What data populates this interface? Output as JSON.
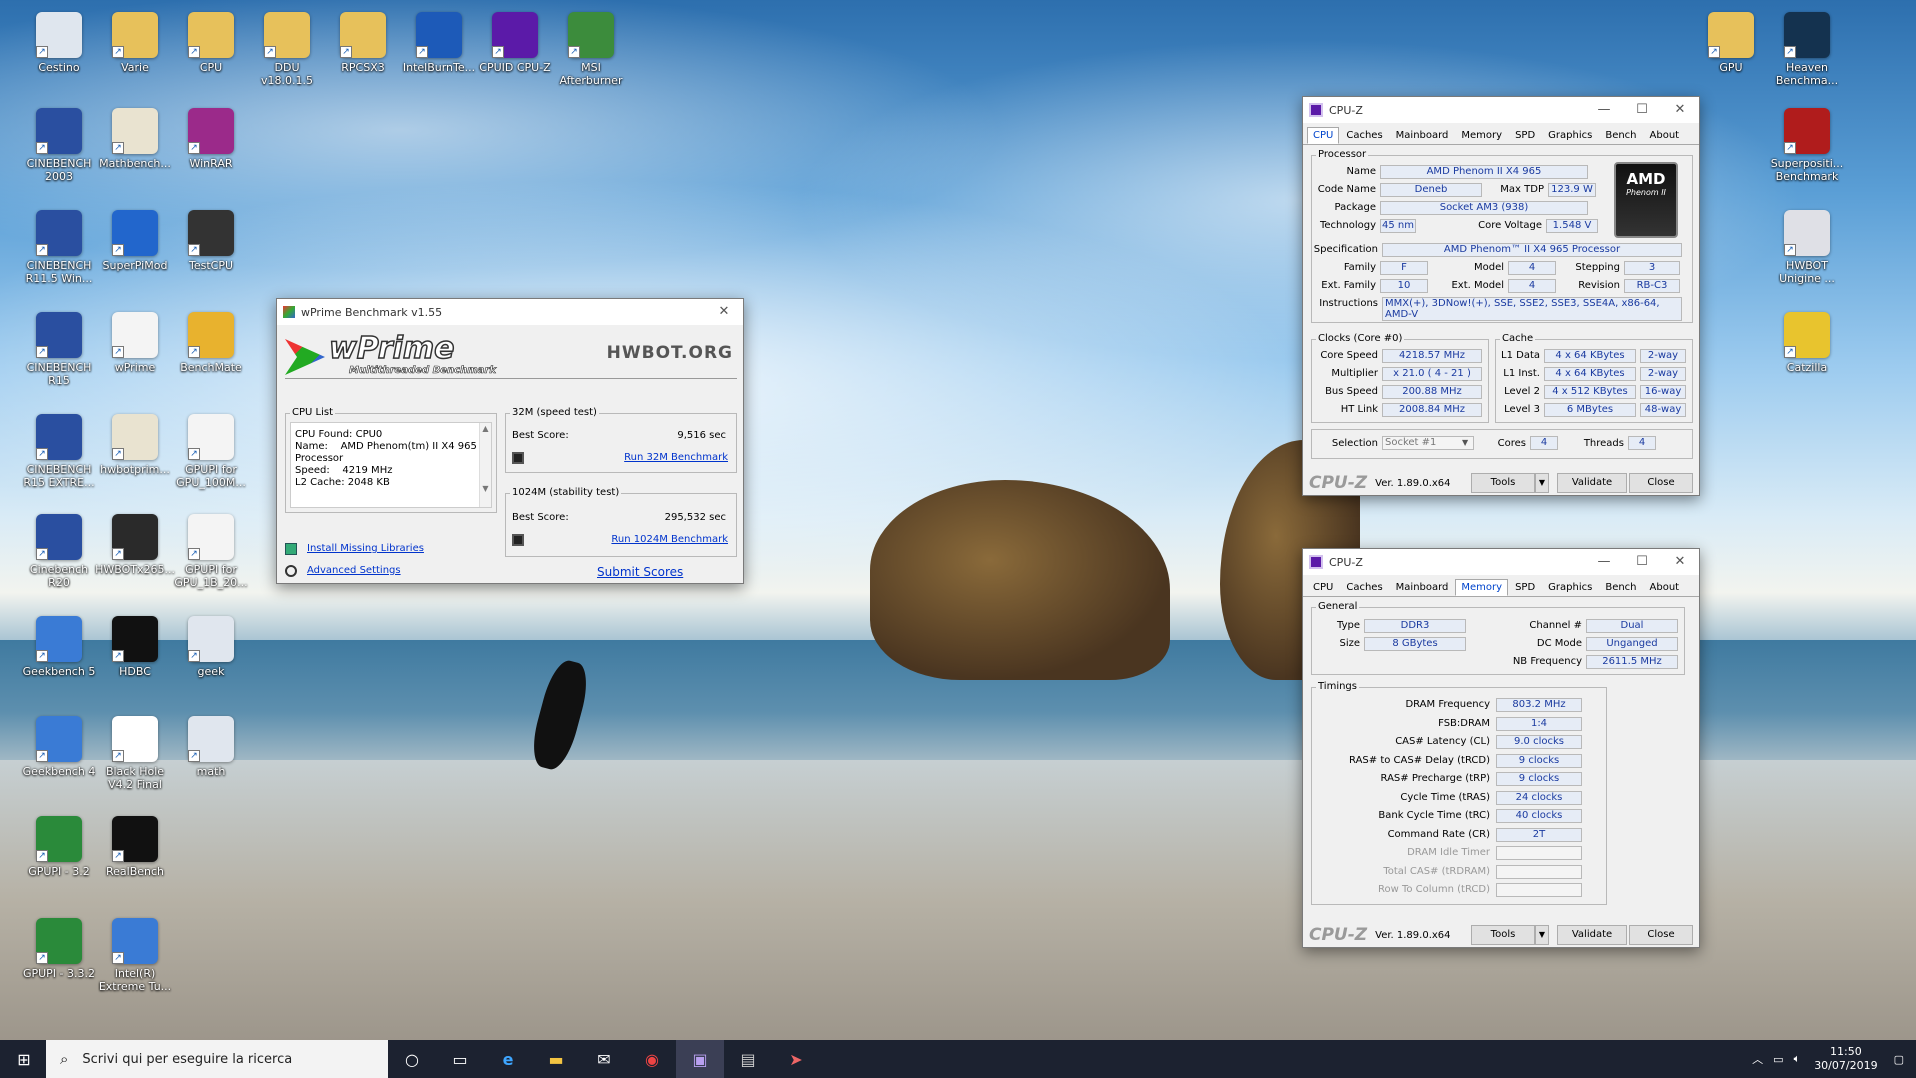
{
  "desktop": {
    "icons": [
      {
        "label": "Cestino",
        "color": "#dfe6ee"
      },
      {
        "label": "Varie",
        "color": "#e7c15b"
      },
      {
        "label": "CPU",
        "color": "#e7c15b"
      },
      {
        "label": "DDU v18.0.1.5",
        "color": "#e7c15b"
      },
      {
        "label": "RPCSX3",
        "color": "#e7c15b"
      },
      {
        "label": "IntelBurnTe...",
        "color": "#1d5ab8"
      },
      {
        "label": "CPUID CPU-Z",
        "color": "#5b1aa8"
      },
      {
        "label": "MSI Afterburner",
        "color": "#3c8c3c"
      },
      {
        "label": "GPU",
        "color": "#e7c15b"
      },
      {
        "label": "Heaven Benchma...",
        "color": "#14324f"
      },
      {
        "label": "CINEBENCH 2003",
        "color": "#2a4fa0"
      },
      {
        "label": "Mathbench...",
        "color": "#e9e3d0"
      },
      {
        "label": "WinRAR",
        "color": "#9b2a8a"
      },
      {
        "label": "Superpositi... Benchmark",
        "color": "#b01c1c"
      },
      {
        "label": "CINEBENCH R11.5 Win...",
        "color": "#2a4fa0"
      },
      {
        "label": "SuperPiMod",
        "color": "#2266cc"
      },
      {
        "label": "TestCPU",
        "color": "#333333"
      },
      {
        "label": "HWBOT Unigine ...",
        "color": "#dfe0e6"
      },
      {
        "label": "CINEBENCH R15",
        "color": "#2a4fa0"
      },
      {
        "label": "wPrime",
        "color": "#f4f4f4"
      },
      {
        "label": "BenchMate",
        "color": "#e8b22e"
      },
      {
        "label": "Catzilla",
        "color": "#e8c42e"
      },
      {
        "label": "CINEBENCH R15 EXTRE...",
        "color": "#2a4fa0"
      },
      {
        "label": "hwbotprim...",
        "color": "#e9e3d0"
      },
      {
        "label": "GPUPI for GPU_100M...",
        "color": "#f4f4f4"
      },
      {
        "label": "Cinebench R20",
        "color": "#2a4fa0"
      },
      {
        "label": "HWBOTx265...",
        "color": "#2a2a2a"
      },
      {
        "label": "GPUPI for GPU_1B_20...",
        "color": "#f4f4f4"
      },
      {
        "label": "Geekbench 5",
        "color": "#3a7bd5"
      },
      {
        "label": "HDBC",
        "color": "#111111"
      },
      {
        "label": "geek",
        "color": "#e0e6ee"
      },
      {
        "label": "Geekbench 4",
        "color": "#3a7bd5"
      },
      {
        "label": "Black Hole V4.2 Final",
        "color": "#ffffff"
      },
      {
        "label": "math",
        "color": "#e0e6ee"
      },
      {
        "label": "GPUPI - 3.2",
        "color": "#2a8a3a"
      },
      {
        "label": "RealBench",
        "color": "#111111"
      },
      {
        "label": "GPUPI - 3.3.2",
        "color": "#2a8a3a"
      },
      {
        "label": "Intel(R) Extreme Tu...",
        "color": "#3a7bd5"
      }
    ]
  },
  "wprime": {
    "title": "wPrime Benchmark v1.55",
    "logo": "wPrime",
    "tagline": "Multithreaded Benchmark",
    "hwbot": "HWBOT.ORG",
    "cpu_list_label": "CPU List",
    "cpu_lines": [
      "CPU Found: CPU0",
      "Name:    AMD Phenom(tm) II X4 965",
      "Processor",
      "Speed:    4219 MHz",
      "L2 Cache: 2048 KB"
    ],
    "t32_label": "32M (speed test)",
    "t32_score_label": "Best Score:",
    "t32_score": "9,516 sec",
    "t32_run": "Run 32M Benchmark",
    "t1024_label": "1024M (stability test)",
    "t1024_score_label": "Best Score:",
    "t1024_score": "295,532 sec",
    "t1024_run": "Run 1024M Benchmark",
    "install": "Install Missing Libraries",
    "advanced": "Advanced Settings",
    "submit": "Submit Scores"
  },
  "cpuz1": {
    "title": "CPU-Z",
    "tabs": [
      "CPU",
      "Caches",
      "Mainboard",
      "Memory",
      "SPD",
      "Graphics",
      "Bench",
      "About"
    ],
    "active_tab": "CPU",
    "processor": "Processor",
    "name_l": "Name",
    "name": "AMD Phenom II X4 965",
    "code_l": "Code Name",
    "code": "Deneb",
    "tdp_l": "Max TDP",
    "tdp": "123.9 W",
    "pkg_l": "Package",
    "pkg": "Socket AM3 (938)",
    "tech_l": "Technology",
    "tech": "45 nm",
    "volt_l": "Core Voltage",
    "volt": "1.548 V",
    "spec_l": "Specification",
    "spec": "AMD Phenom™ II X4 965 Processor",
    "fam_l": "Family",
    "fam": "F",
    "model_l": "Model",
    "model": "4",
    "step_l": "Stepping",
    "step": "3",
    "efam_l": "Ext. Family",
    "efam": "10",
    "emodel_l": "Ext. Model",
    "emodel": "4",
    "rev_l": "Revision",
    "rev": "RB-C3",
    "instr_l": "Instructions",
    "instr": "MMX(+), 3DNow!(+), SSE, SSE2, SSE3, SSE4A, x86-64, AMD-V",
    "clocks": "Clocks (Core #0)",
    "cache": "Cache",
    "cs_l": "Core Speed",
    "cs": "4218.57 MHz",
    "mul_l": "Multiplier",
    "mul": "x 21.0 ( 4 - 21 )",
    "bus_l": "Bus Speed",
    "bus": "200.88 MHz",
    "ht_l": "HT Link",
    "ht": "2008.84 MHz",
    "l1d_l": "L1 Data",
    "l1d": "4 x 64 KBytes",
    "l1d_w": "2-way",
    "l1i_l": "L1 Inst.",
    "l1i": "4 x 64 KBytes",
    "l1i_w": "2-way",
    "l2_l": "Level 2",
    "l2": "4 x 512 KBytes",
    "l2_w": "16-way",
    "l3_l": "Level 3",
    "l3": "6 MBytes",
    "l3_w": "48-way",
    "sel_l": "Selection",
    "sel": "Socket #1",
    "cores_l": "Cores",
    "cores": "4",
    "thr_l": "Threads",
    "thr": "4",
    "logo": "CPU-Z",
    "version": "Ver. 1.89.0.x64",
    "tools": "Tools",
    "validate": "Validate",
    "close": "Close",
    "amd": "AMD",
    "phenom": "Phenom II"
  },
  "cpuz2": {
    "title": "CPU-Z",
    "tabs": [
      "CPU",
      "Caches",
      "Mainboard",
      "Memory",
      "SPD",
      "Graphics",
      "Bench",
      "About"
    ],
    "active_tab": "Memory",
    "general": "General",
    "type_l": "Type",
    "type": "DDR3",
    "size_l": "Size",
    "size": "8 GBytes",
    "ch_l": "Channel #",
    "ch": "Dual",
    "dc_l": "DC Mode",
    "dc": "Unganged",
    "nb_l": "NB Frequency",
    "nb": "2611.5 MHz",
    "timings": "Timings",
    "rows": [
      {
        "l": "DRAM Frequency",
        "v": "803.2 MHz",
        "dim": false
      },
      {
        "l": "FSB:DRAM",
        "v": "1:4",
        "dim": false
      },
      {
        "l": "CAS# Latency (CL)",
        "v": "9.0 clocks",
        "dim": false
      },
      {
        "l": "RAS# to CAS# Delay (tRCD)",
        "v": "9 clocks",
        "dim": false
      },
      {
        "l": "RAS# Precharge (tRP)",
        "v": "9 clocks",
        "dim": false
      },
      {
        "l": "Cycle Time (tRAS)",
        "v": "24 clocks",
        "dim": false
      },
      {
        "l": "Bank Cycle Time (tRC)",
        "v": "40 clocks",
        "dim": false
      },
      {
        "l": "Command Rate (CR)",
        "v": "2T",
        "dim": false
      },
      {
        "l": "DRAM Idle Timer",
        "v": "",
        "dim": true
      },
      {
        "l": "Total CAS# (tRDRAM)",
        "v": "",
        "dim": true
      },
      {
        "l": "Row To Column (tRCD)",
        "v": "",
        "dim": true
      }
    ],
    "logo": "CPU-Z",
    "version": "Ver. 1.89.0.x64",
    "tools": "Tools",
    "validate": "Validate",
    "close": "Close"
  },
  "taskbar": {
    "search": "Scrivi qui per eseguire la ricerca",
    "time": "11:50",
    "date": "30/07/2019"
  }
}
